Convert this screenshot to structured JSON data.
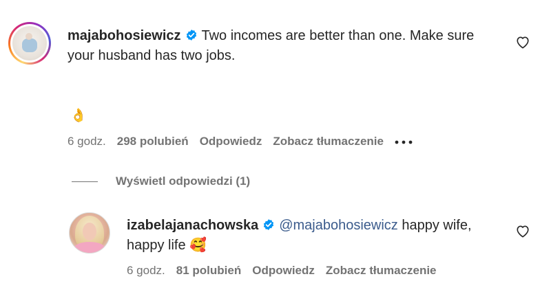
{
  "comments": [
    {
      "username": "majabohosiewicz",
      "verified": true,
      "text": "Two incomes are better than one. Make sure your husband has two jobs.",
      "emoji": "👌",
      "time": "6 godz.",
      "likes": "298 polubień",
      "reply_label": "Odpowiedz",
      "translate_label": "Zobacz tłumaczenie",
      "more_icon": "more-horizontal-icon"
    }
  ],
  "view_replies": "Wyświetl odpowiedzi (1)",
  "reply": {
    "username": "izabelajanachowska",
    "verified": true,
    "mention": "@majabohosiewicz",
    "text": "happy wife, happy life",
    "emoji": "🥰",
    "time": "6 godz.",
    "likes": "81 polubień",
    "reply_label": "Odpowiedz",
    "translate_label": "Zobacz tłumaczenie"
  },
  "icons": {
    "like": "heart-icon",
    "verified": "verified-badge-icon"
  },
  "colors": {
    "verified": "#0095f6",
    "meta": "#737373",
    "mention": "#3b5b8c"
  }
}
